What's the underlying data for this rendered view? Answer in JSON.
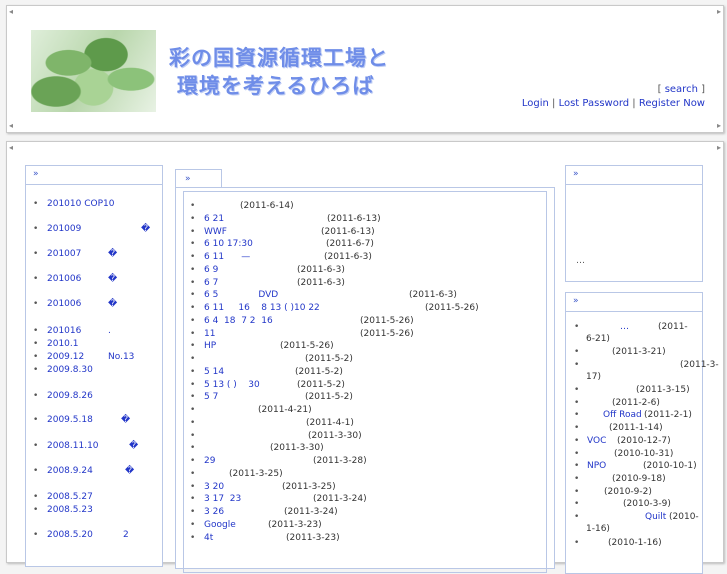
{
  "header": {
    "title_line1": "彩の国資源循環工場と",
    "title_line2": "環境を考えるひろば",
    "search_label": "search",
    "login_label": "Login",
    "lost_password_label": "Lost Password",
    "register_label": "Register Now"
  },
  "left_menu": {
    "items": [
      {
        "label": "201010 COP10",
        "extra": ""
      },
      {
        "label": "201009",
        "extra": "�"
      },
      {
        "label": "201007",
        "extra": "�"
      },
      {
        "label": "201006",
        "extra": "�"
      },
      {
        "label": "201006",
        "extra": "�"
      },
      {
        "label": "201016",
        "extra": "."
      },
      {
        "label": "2010.1",
        "extra": ""
      },
      {
        "label": "2009.12",
        "extra": "No.13"
      },
      {
        "label": "2009.8.30",
        "extra": ""
      },
      {
        "label": "2009.8.26",
        "extra": ""
      },
      {
        "label": "2009.5.18",
        "extra": "�"
      },
      {
        "label": "2008.11.10",
        "extra": "�"
      },
      {
        "label": "2008.9.24",
        "extra": "�"
      },
      {
        "label": "2008.5.27",
        "extra": ""
      },
      {
        "label": "2008.5.23",
        "extra": ""
      },
      {
        "label": "2008.5.20",
        "extra": "2"
      }
    ]
  },
  "news": {
    "items": [
      {
        "link": "",
        "date": "(2011-6-14)"
      },
      {
        "link": "6 21",
        "date": "(2011-6-13)"
      },
      {
        "link": "WWF",
        "date": "(2011-6-13)"
      },
      {
        "link": "6 10 17:30",
        "date": "(2011-6-7)"
      },
      {
        "link": "6 11      —",
        "date": "(2011-6-3)"
      },
      {
        "link": "6 9",
        "date": "(2011-6-3)"
      },
      {
        "link": "6 7",
        "date": "(2011-6-3)"
      },
      {
        "link": "6 5              DVD",
        "date": "(2011-6-3)"
      },
      {
        "link": "6 11     16    8 13 ( )10 22",
        "date": "(2011-5-26)"
      },
      {
        "link": "6 4  18  7 2  16",
        "date": "(2011-5-26)"
      },
      {
        "link": "11",
        "date": "(2011-5-26)"
      },
      {
        "link": "HP",
        "date": "(2011-5-26)"
      },
      {
        "link": "",
        "date": "(2011-5-2)"
      },
      {
        "link": "5 14",
        "date": "(2011-5-2)"
      },
      {
        "link": "5 13 ( )    30",
        "date": "(2011-5-2)"
      },
      {
        "link": "5 7",
        "date": "(2011-5-2)"
      },
      {
        "link": "",
        "date": "(2011-4-21)"
      },
      {
        "link": "",
        "date": "(2011-4-1)"
      },
      {
        "link": "",
        "date": "(2011-3-30)"
      },
      {
        "link": "",
        "date": "(2011-3-30)"
      },
      {
        "link": "29",
        "date": "(2011-3-28)"
      },
      {
        "link": "",
        "date": "(2011-3-25)"
      },
      {
        "link": "3 20",
        "date": "(2011-3-25)"
      },
      {
        "link": "3 17  23",
        "date": "(2011-3-24)"
      },
      {
        "link": "3 26",
        "date": "(2011-3-24)"
      },
      {
        "link": "Google",
        "date": "(2011-3-23)"
      },
      {
        "link": "4t",
        "date": "(2011-3-23)"
      }
    ]
  },
  "right_top": {
    "text": "…"
  },
  "right_list": {
    "items": [
      {
        "link": "…",
        "date": "(2011-",
        "date2": "6-21)"
      },
      {
        "link": "",
        "date": "(2011-3-21)",
        "date2": ""
      },
      {
        "link": "",
        "date": "(2011-3-",
        "date2": "17)"
      },
      {
        "link": "",
        "date": "(2011-3-15)",
        "date2": ""
      },
      {
        "link": "",
        "date": "(2011-2-6)",
        "date2": ""
      },
      {
        "link": "Off Road",
        "date": "(2011-2-1)",
        "date2": ""
      },
      {
        "link": "",
        "date": "(2011-1-14)",
        "date2": ""
      },
      {
        "link": "VOC",
        "date": "(2010-12-7)",
        "date2": ""
      },
      {
        "link": "",
        "date": "(2010-10-31)",
        "date2": ""
      },
      {
        "link": "NPO",
        "date": "(2010-10-1)",
        "date2": ""
      },
      {
        "link": "",
        "date": "(2010-9-18)",
        "date2": ""
      },
      {
        "link": "",
        "date": "(2010-9-2)",
        "date2": ""
      },
      {
        "link": "",
        "date": "(2010-3-9)",
        "date2": ""
      },
      {
        "link": "Quilt",
        "date": "(2010-",
        "date2": "1-16)"
      },
      {
        "link": "",
        "date": "(2010-1-16)",
        "date2": ""
      }
    ]
  }
}
